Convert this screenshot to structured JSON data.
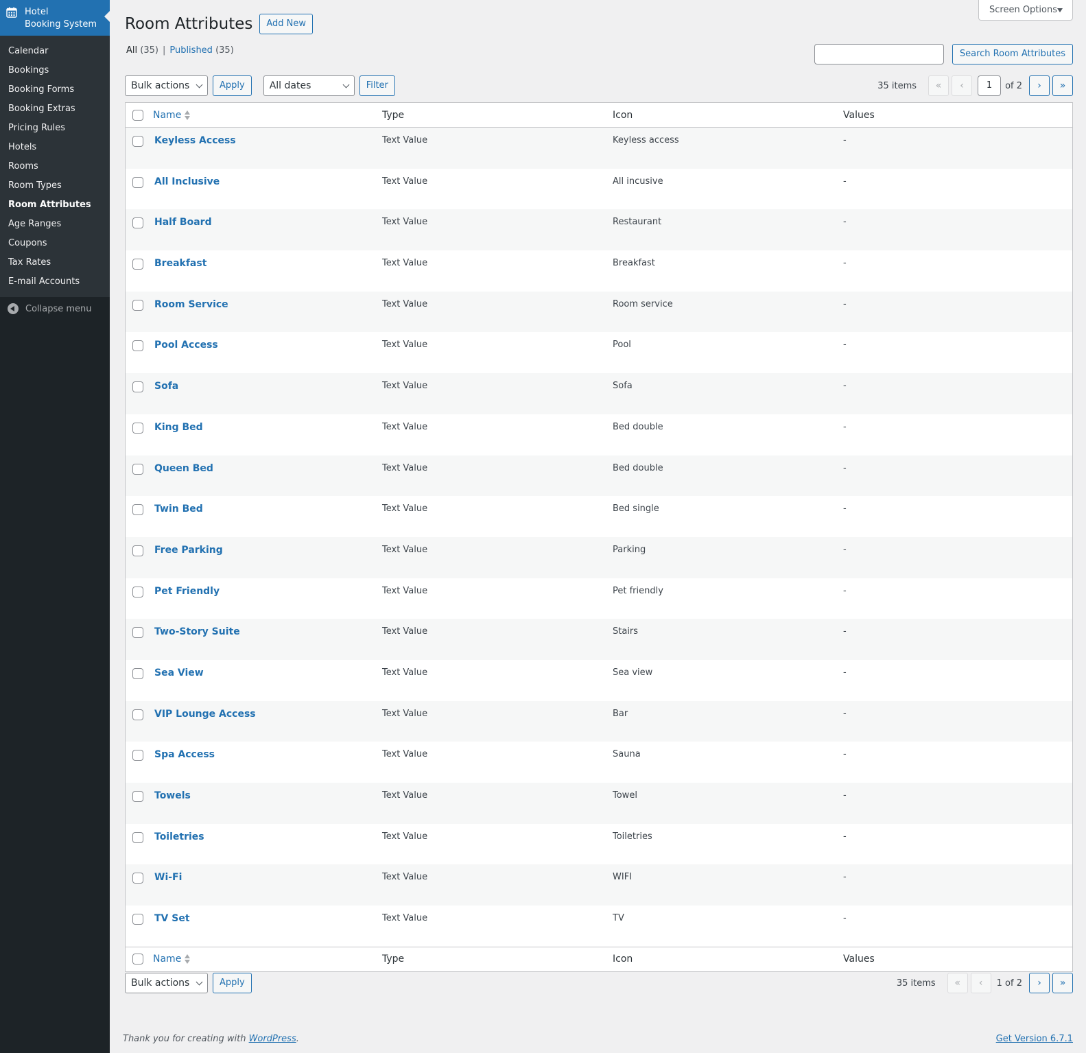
{
  "sidebar": {
    "brand_line1": "Hotel",
    "brand_line2": "Booking System",
    "items": [
      {
        "label": "Calendar"
      },
      {
        "label": "Bookings"
      },
      {
        "label": "Booking Forms"
      },
      {
        "label": "Booking Extras"
      },
      {
        "label": "Pricing Rules"
      },
      {
        "label": "Hotels"
      },
      {
        "label": "Rooms"
      },
      {
        "label": "Room Types"
      },
      {
        "label": "Room Attributes",
        "current": true
      },
      {
        "label": "Age Ranges"
      },
      {
        "label": "Coupons"
      },
      {
        "label": "Tax Rates"
      },
      {
        "label": "E-mail Accounts"
      }
    ],
    "collapse_label": "Collapse menu"
  },
  "header": {
    "screen_options": "Screen Options",
    "title": "Room Attributes",
    "add_new": "Add New"
  },
  "filters": {
    "all_label": "All",
    "all_count": "(35)",
    "published_label": "Published",
    "published_count": "(35)",
    "separator": "|"
  },
  "search": {
    "placeholder": "",
    "button": "Search Room Attributes"
  },
  "tablenav_top": {
    "bulk_actions": "Bulk actions",
    "apply": "Apply",
    "dates": "All dates",
    "filter": "Filter",
    "items_count": "35 items",
    "first": "«",
    "prev": "‹",
    "current_page": "1",
    "of_pages": "of 2",
    "next": "›",
    "last": "»"
  },
  "table": {
    "columns": {
      "name": "Name",
      "type": "Type",
      "icon": "Icon",
      "values": "Values"
    },
    "rows": [
      {
        "name": "Keyless Access",
        "type": "Text Value",
        "icon": "Keyless access",
        "values": "-"
      },
      {
        "name": "All Inclusive",
        "type": "Text Value",
        "icon": "All incusive",
        "values": "-"
      },
      {
        "name": "Half Board",
        "type": "Text Value",
        "icon": "Restaurant",
        "values": "-"
      },
      {
        "name": "Breakfast",
        "type": "Text Value",
        "icon": "Breakfast",
        "values": "-"
      },
      {
        "name": "Room Service",
        "type": "Text Value",
        "icon": "Room service",
        "values": "-"
      },
      {
        "name": "Pool Access",
        "type": "Text Value",
        "icon": "Pool",
        "values": "-"
      },
      {
        "name": "Sofa",
        "type": "Text Value",
        "icon": "Sofa",
        "values": "-"
      },
      {
        "name": "King Bed",
        "type": "Text Value",
        "icon": "Bed double",
        "values": "-"
      },
      {
        "name": "Queen Bed",
        "type": "Text Value",
        "icon": "Bed double",
        "values": "-"
      },
      {
        "name": "Twin Bed",
        "type": "Text Value",
        "icon": "Bed single",
        "values": "-"
      },
      {
        "name": "Free Parking",
        "type": "Text Value",
        "icon": "Parking",
        "values": "-"
      },
      {
        "name": "Pet Friendly",
        "type": "Text Value",
        "icon": "Pet friendly",
        "values": "-"
      },
      {
        "name": "Two-Story Suite",
        "type": "Text Value",
        "icon": "Stairs",
        "values": "-"
      },
      {
        "name": "Sea View",
        "type": "Text Value",
        "icon": "Sea view",
        "values": "-"
      },
      {
        "name": "VIP Lounge Access",
        "type": "Text Value",
        "icon": "Bar",
        "values": "-"
      },
      {
        "name": "Spa Access",
        "type": "Text Value",
        "icon": "Sauna",
        "values": "-"
      },
      {
        "name": "Towels",
        "type": "Text Value",
        "icon": "Towel",
        "values": "-"
      },
      {
        "name": "Toiletries",
        "type": "Text Value",
        "icon": "Toiletries",
        "values": "-"
      },
      {
        "name": "Wi-Fi",
        "type": "Text Value",
        "icon": "WIFI",
        "values": "-"
      },
      {
        "name": "TV Set",
        "type": "Text Value",
        "icon": "TV",
        "values": "-"
      }
    ]
  },
  "tablenav_bottom": {
    "bulk_actions": "Bulk actions",
    "apply": "Apply",
    "items_count": "35 items",
    "first": "«",
    "prev": "‹",
    "page_text": "1 of 2",
    "next": "›",
    "last": "»"
  },
  "footer": {
    "thanks_prefix": "Thank you for creating with ",
    "wordpress": "WordPress",
    "thanks_suffix": ".",
    "version": "Get Version 6.7.1"
  }
}
